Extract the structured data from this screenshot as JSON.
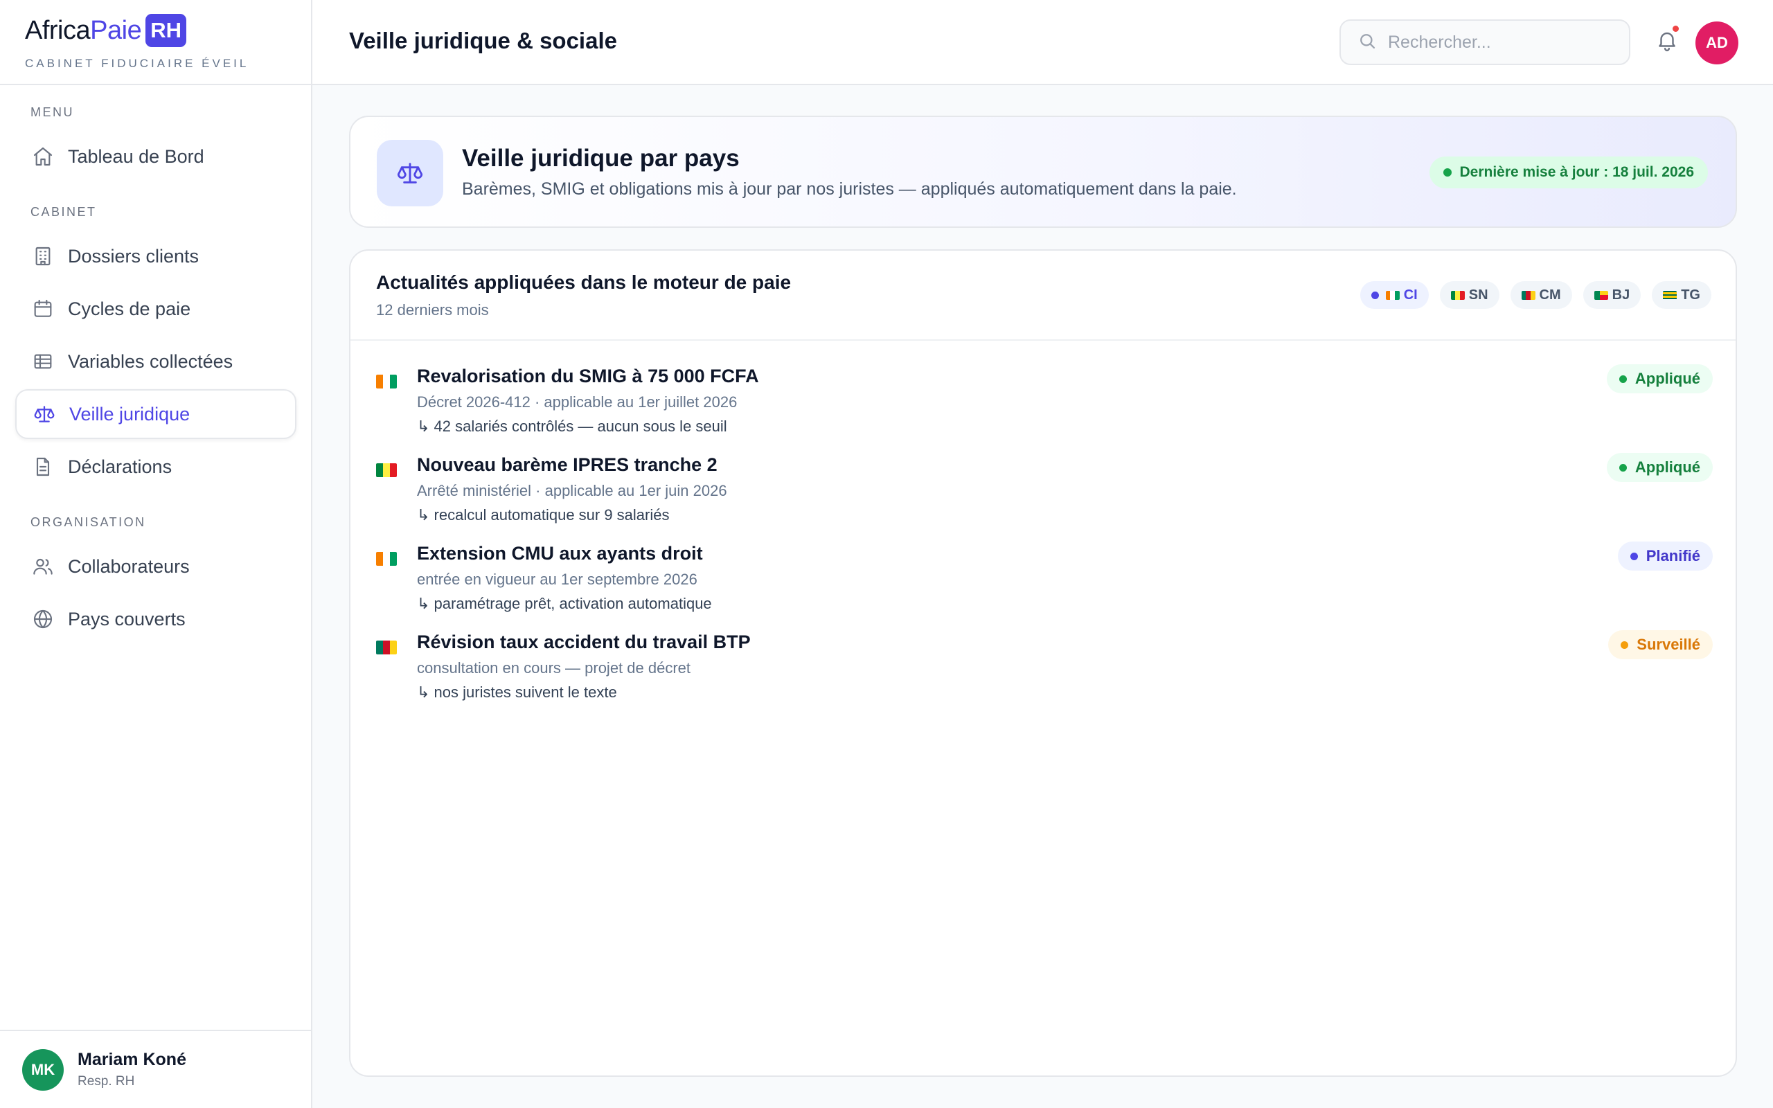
{
  "brand": {
    "part1": "Africa",
    "part2": "Paie",
    "badge": "RH",
    "subtitle": "CABINET FIDUCIAIRE ÉVEIL"
  },
  "sidebar": {
    "sections": [
      "MENU",
      "CABINET",
      "ORGANISATION"
    ],
    "items": [
      {
        "label": "Tableau de Bord",
        "icon": "home-icon"
      },
      {
        "label": "Dossiers clients",
        "icon": "building-icon"
      },
      {
        "label": "Cycles de paie",
        "icon": "calendar-icon"
      },
      {
        "label": "Variables collectées",
        "icon": "table-icon"
      },
      {
        "label": "Veille juridique",
        "icon": "scale-icon",
        "active": true
      },
      {
        "label": "Déclarations",
        "icon": "document-icon"
      },
      {
        "label": "Collaborateurs",
        "icon": "users-icon"
      },
      {
        "label": "Pays couverts",
        "icon": "globe-icon"
      }
    ],
    "user": {
      "initials": "MK",
      "name": "Mariam Koné",
      "role": "Resp. RH"
    }
  },
  "header": {
    "title": "Veille juridique & sociale",
    "search_placeholder": "Rechercher...",
    "avatar_initials": "AD"
  },
  "hero": {
    "title": "Veille juridique par pays",
    "subtitle": "Barèmes, SMIG et obligations mis à jour par nos juristes — appliqués automatiquement dans la paie.",
    "update": "Dernière mise à jour : 18 juil. 2026"
  },
  "news": {
    "title": "Actualités appliquées dans le moteur de paie",
    "subtitle": "12 derniers mois",
    "countries": [
      "CI",
      "SN",
      "CM",
      "BJ",
      "TG"
    ],
    "items": [
      {
        "country": "CI",
        "title": "Revalorisation du SMIG à 75 000 FCFA",
        "meta": "Décret 2026-412 · applicable au 1er juillet 2026",
        "note": "↳ 42 salariés contrôlés — aucun sous le seuil",
        "status": "Appliqué"
      },
      {
        "country": "SN",
        "title": "Nouveau barème IPRES tranche 2",
        "meta": "Arrêté ministériel · applicable au 1er juin 2026",
        "note": "↳ recalcul automatique sur 9 salariés",
        "status": "Appliqué"
      },
      {
        "country": "CI",
        "title": "Extension CMU aux ayants droit",
        "meta": "entrée en vigueur au 1er septembre 2026",
        "note": "↳ paramétrage prêt, activation automatique",
        "status": "Planifié"
      },
      {
        "country": "CM",
        "title": "Révision taux accident du travail BTP",
        "meta": "consultation en cours — projet de décret",
        "note": "↳ nos juristes suivent le texte",
        "status": "Surveillé"
      }
    ]
  },
  "colors": {
    "accent": "#4f46e5",
    "applied": "#15803d",
    "planned": "#4338ca",
    "watched": "#d97706"
  }
}
